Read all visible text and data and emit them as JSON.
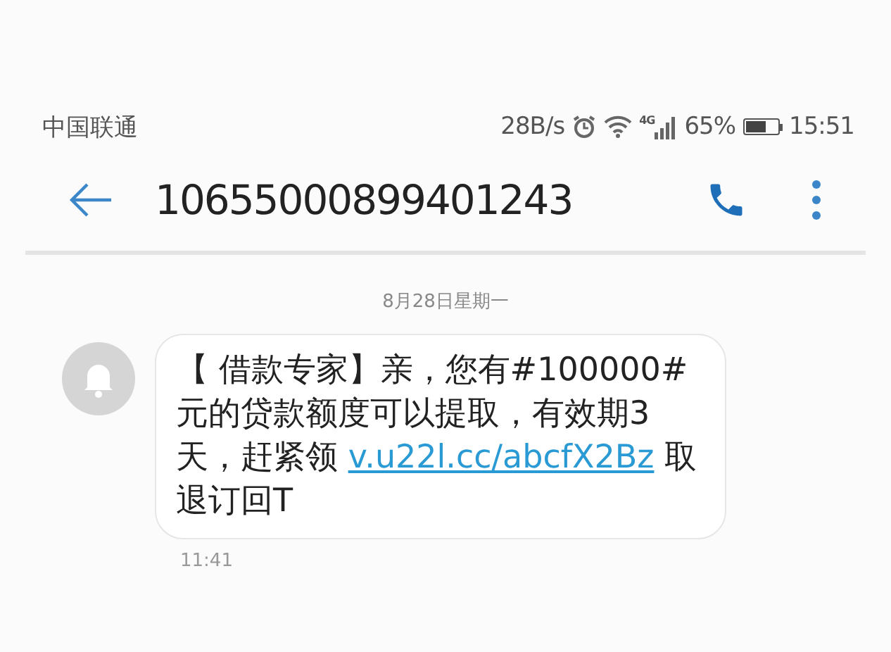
{
  "status_bar": {
    "carrier": "中国联通",
    "speed": "28B/s",
    "network": "4G",
    "battery_text": "65%",
    "time": "15:51"
  },
  "header": {
    "title": "10655000899401243"
  },
  "conversation": {
    "date": "8月28日星期一",
    "messages": [
      {
        "text_before": "【 借款专家】亲，您有#100000#元的贷款额度可以提取，有效期3天，赶紧领 ",
        "link": "v.u22l.cc/abcfX2Bz",
        "text_after": " 取退订回T",
        "time": "11:41"
      }
    ]
  }
}
